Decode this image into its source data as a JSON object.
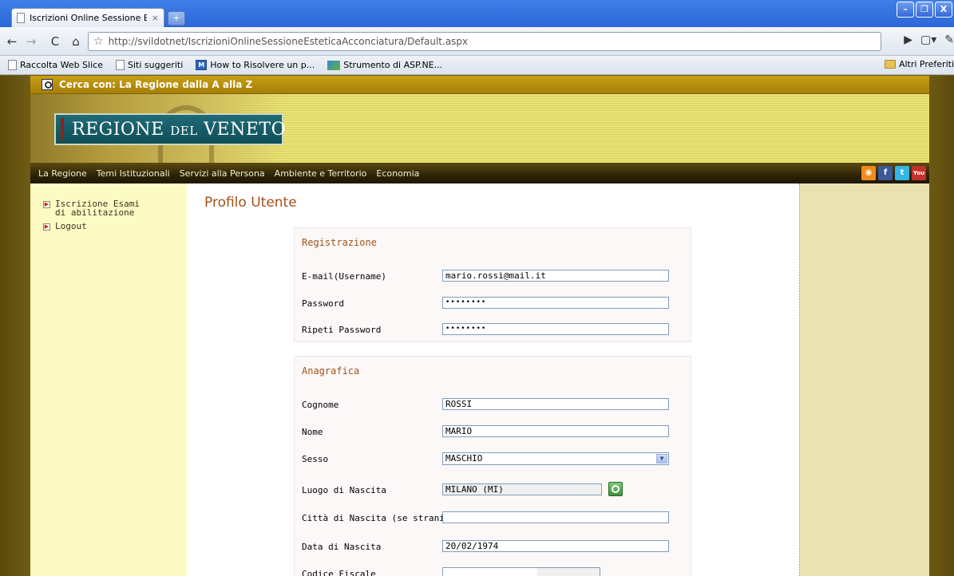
{
  "browser": {
    "tab_title": "Iscrizioni Online Sessione E...",
    "tab_close": "×",
    "new_tab": "+",
    "url": "http://svildotnet/IscrizioniOnlineSessioneEsteticaAcconciatura/Default.aspx",
    "window_controls": [
      "–",
      "❐",
      "X"
    ],
    "bookmarks": [
      {
        "label": "Raccolta Web Slice",
        "icon": "page-icon"
      },
      {
        "label": "Siti suggeriti",
        "icon": "page-icon"
      },
      {
        "label": "How to Risolvere un p...",
        "icon": "m-logo-icon"
      },
      {
        "label": "Strumento di ASP.NE...",
        "icon": "asp-icon"
      }
    ],
    "other_bookmarks": "Altri Preferiti"
  },
  "site": {
    "search_text": "Cerca con: La Regione dalla A alla Z",
    "logo_main": "REGIONE ",
    "logo_del": "DEL",
    "logo_end": " VENETO",
    "menu": [
      "La Regione",
      "Temi Istituzionali",
      "Servizi alla Persona",
      "Ambiente e Territorio",
      "Economia"
    ],
    "social": [
      {
        "icon": "rss-icon",
        "glyph": "◉",
        "color": "#f08a1c"
      },
      {
        "icon": "facebook-icon",
        "glyph": "f",
        "color": "#3b5998"
      },
      {
        "icon": "twitter-icon",
        "glyph": "t",
        "color": "#33b5e5"
      },
      {
        "icon": "youtube-icon",
        "glyph": "You",
        "color": "#c4302b"
      }
    ]
  },
  "sidebar": {
    "items": [
      {
        "label_line1": "Iscrizione Esami",
        "label_line2": "di abilitazione"
      },
      {
        "label_line1": "Logout",
        "label_line2": ""
      }
    ]
  },
  "page": {
    "title": "Profilo Utente"
  },
  "registrazione": {
    "heading": "Registrazione",
    "email_label": "E-mail(Username)",
    "email_value": "mario.rossi@mail.it",
    "password_label": "Password",
    "password_value": "••••••••",
    "repeat_label": "Ripeti Password",
    "repeat_value": "••••••••"
  },
  "anagrafica": {
    "heading": "Anagrafica",
    "cognome_label": "Cognome",
    "cognome_value": "ROSSI",
    "nome_label": "Nome",
    "nome_value": "MARIO",
    "sesso_label": "Sesso",
    "sesso_value": "MASCHIO",
    "luogo_label": "Luogo di Nascita",
    "luogo_value": "MILANO (MI)",
    "citta_label": "Città di Nascita (se stranieri)",
    "citta_value": "",
    "data_label": "Data di Nascita",
    "data_value": "20/02/1974",
    "cf_label": "Codice Fiscale",
    "cf_value": ""
  }
}
